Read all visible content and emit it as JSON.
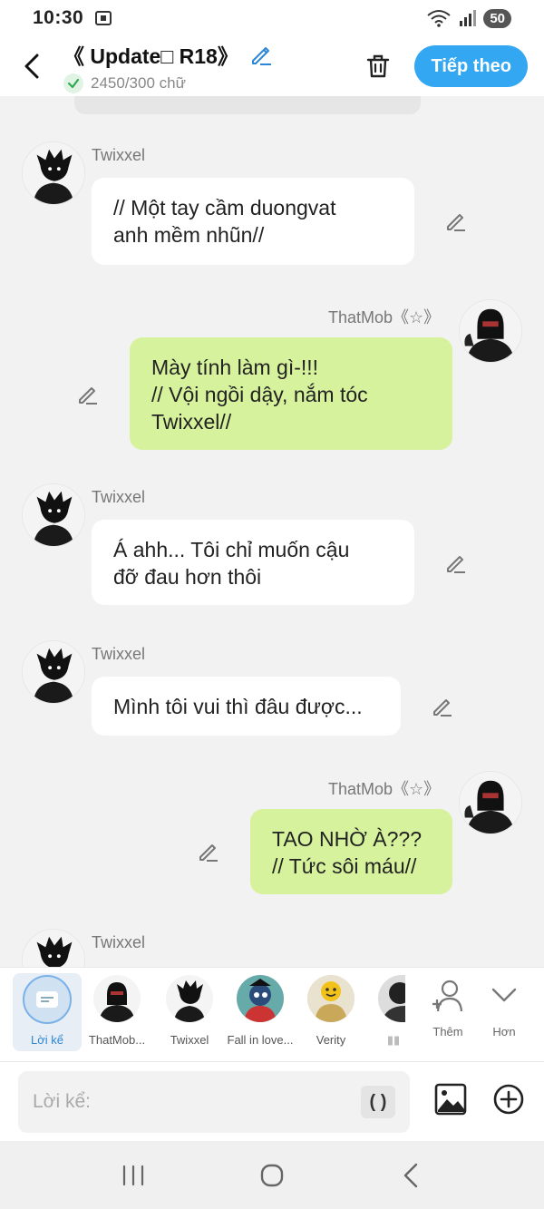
{
  "status": {
    "time": "10:30",
    "battery": "50"
  },
  "header": {
    "title": "《 Update□ R18》",
    "counter": "2450/300 chữ",
    "next_label": "Tiếp theo"
  },
  "messages": [
    {
      "side": "left",
      "name": "Twixxel",
      "text": "// Một tay cầm duongvat\nanh mềm nhũn//"
    },
    {
      "side": "right",
      "name": "ThatMob《☆》",
      "text": "Mày tính làm gì-!!!\n// Vội ngồi dậy, nắm tóc\nTwixxel//"
    },
    {
      "side": "left",
      "name": "Twixxel",
      "text": "Á ahh... Tôi chỉ muốn cậu\nđỡ đau hơn thôi"
    },
    {
      "side": "left",
      "name": "Twixxel",
      "text": "Mình tôi vui thì đâu được..."
    },
    {
      "side": "right",
      "name": "ThatMob《☆》",
      "text": "TAO NHỜ À???\n// Tức sôi máu//"
    },
    {
      "side": "left",
      "name": "Twixxel",
      "text": ""
    }
  ],
  "characters": [
    {
      "label": "Lời kể",
      "icon": "narration-icon"
    },
    {
      "label": "ThatMob...",
      "icon": "thatmob-avatar"
    },
    {
      "label": "Twixxel",
      "icon": "twixxel-avatar"
    },
    {
      "label": "Fall in love...",
      "icon": "fall-in-love-avatar"
    },
    {
      "label": "Verity",
      "icon": "verity-avatar"
    },
    {
      "label": "▮▮",
      "icon": "partial-avatar"
    }
  ],
  "tools": {
    "add_label": "Thêm",
    "more_label": "Hơn"
  },
  "input": {
    "placeholder": "Lời kể:",
    "paren": "( )"
  },
  "colors": {
    "accent": "#33a7f2",
    "right_bubble": "#d7f29c",
    "left_bubble": "#ffffff"
  }
}
